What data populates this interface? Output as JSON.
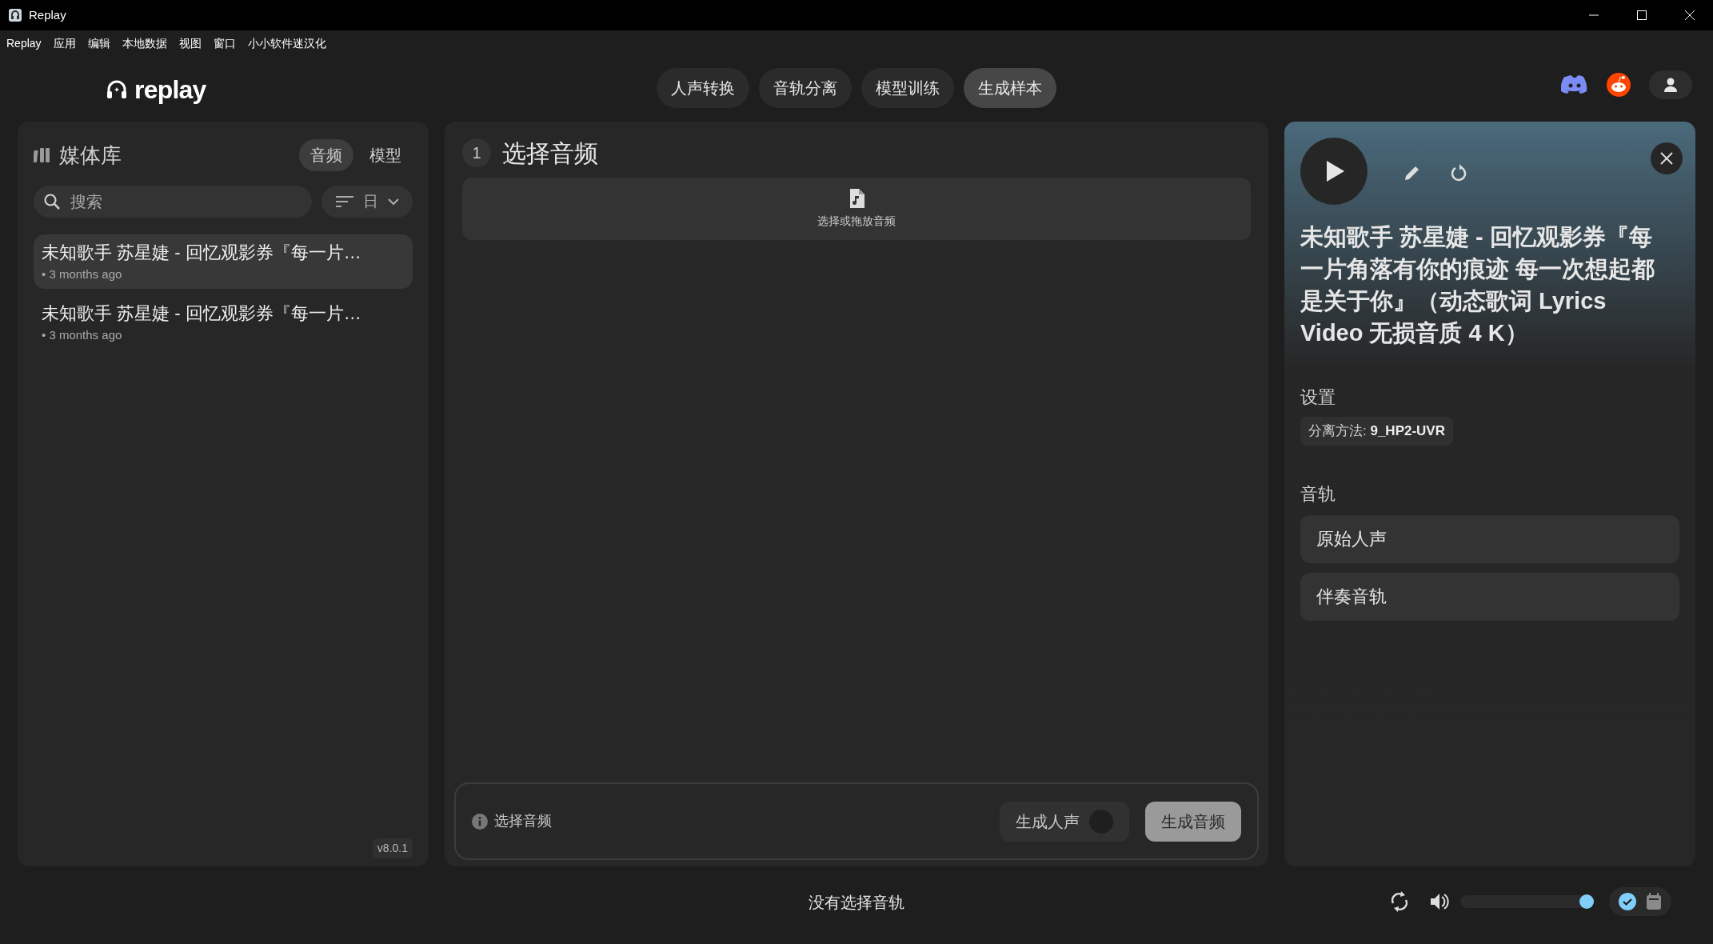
{
  "window": {
    "title": "Replay"
  },
  "menu": [
    "Replay",
    "应用",
    "编辑",
    "本地数据",
    "视图",
    "窗口",
    "小小软件迷汉化"
  ],
  "logo": "replay",
  "nav_tabs": [
    {
      "label": "人声转换",
      "selected": false
    },
    {
      "label": "音轨分离",
      "selected": false
    },
    {
      "label": "模型训练",
      "selected": false
    },
    {
      "label": "生成样本",
      "selected": true
    }
  ],
  "library": {
    "title": "媒体库",
    "tabs": [
      {
        "label": "音频",
        "selected": true
      },
      {
        "label": "模型",
        "selected": false
      }
    ],
    "search": {
      "placeholder": "搜索"
    },
    "sort": "日",
    "items": [
      {
        "title": "未知歌手 苏星婕 - 回忆观影券『每一片…",
        "meta": "• 3 months ago",
        "selected": true
      },
      {
        "title": "未知歌手 苏星婕 - 回忆观影券『每一片…",
        "meta": "• 3 months ago",
        "selected": false
      }
    ],
    "version": "v8.0.1"
  },
  "main": {
    "step": "1",
    "title": "选择音频",
    "dropzone": "选择或拖放音频",
    "footer": {
      "hint": "选择音频",
      "toggle": {
        "label": "生成人声",
        "on": false
      },
      "button": {
        "label": "生成音频",
        "disabled": true
      }
    }
  },
  "details": {
    "title": "未知歌手 苏星婕 - 回忆观影券『每一片角落有你的痕迹 每一次想起都是关于你』（动态歌词 Lyrics Video 无损音质 4 K）",
    "settings_heading": "设置",
    "setting": {
      "label": "分离方法:",
      "value": "9_HP2-UVR"
    },
    "tracks_heading": "音轨",
    "tracks": [
      "原始人声",
      "伴奏音轨"
    ]
  },
  "player": {
    "status": "没有选择音轨",
    "volume": {
      "level": 0.95
    },
    "modes": [
      {
        "kind": "check",
        "selected": true
      },
      {
        "kind": "calendar",
        "selected": false
      }
    ]
  }
}
